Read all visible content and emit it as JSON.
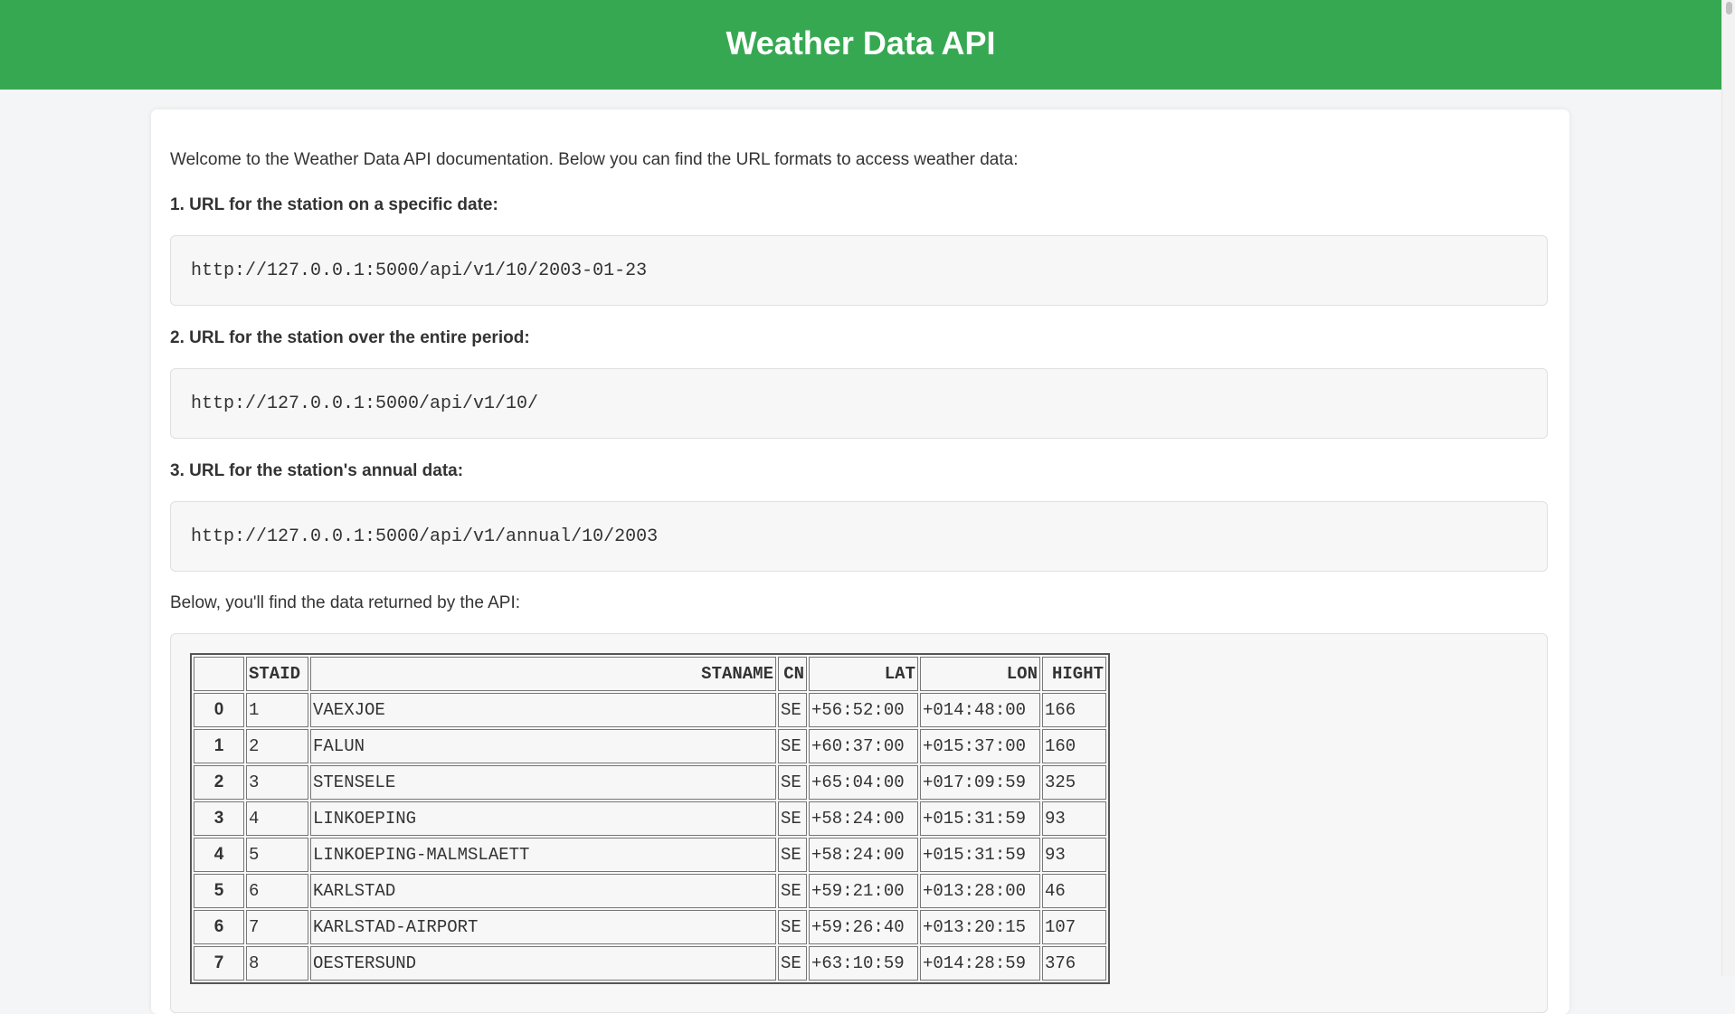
{
  "header": {
    "title": "Weather Data API"
  },
  "intro": "Welcome to the Weather Data API documentation. Below you can find the URL formats to access weather data:",
  "sections": [
    {
      "title": "1. URL for the station on a specific date:",
      "url": "http://127.0.0.1:5000/api/v1/10/2003-01-23"
    },
    {
      "title": "2. URL for the station over the entire period:",
      "url": "http://127.0.0.1:5000/api/v1/10/"
    },
    {
      "title": "3. URL for the station's annual data:",
      "url": "http://127.0.0.1:5000/api/v1/annual/10/2003"
    }
  ],
  "below_text": "Below, you'll find the data returned by the API:",
  "table": {
    "columns": [
      "",
      "STAID",
      "STANAME",
      "CN",
      "LAT",
      "LON",
      "HIGHT"
    ],
    "rows": [
      {
        "index": "0",
        "staid": "1",
        "staname": "VAEXJOE",
        "cn": "SE",
        "lat": "+56:52:00",
        "lon": "+014:48:00",
        "hight": "166"
      },
      {
        "index": "1",
        "staid": "2",
        "staname": "FALUN",
        "cn": "SE",
        "lat": "+60:37:00",
        "lon": "+015:37:00",
        "hight": "160"
      },
      {
        "index": "2",
        "staid": "3",
        "staname": "STENSELE",
        "cn": "SE",
        "lat": "+65:04:00",
        "lon": "+017:09:59",
        "hight": "325"
      },
      {
        "index": "3",
        "staid": "4",
        "staname": "LINKOEPING",
        "cn": "SE",
        "lat": "+58:24:00",
        "lon": "+015:31:59",
        "hight": "93"
      },
      {
        "index": "4",
        "staid": "5",
        "staname": "LINKOEPING-MALMSLAETT",
        "cn": "SE",
        "lat": "+58:24:00",
        "lon": "+015:31:59",
        "hight": "93"
      },
      {
        "index": "5",
        "staid": "6",
        "staname": "KARLSTAD",
        "cn": "SE",
        "lat": "+59:21:00",
        "lon": "+013:28:00",
        "hight": "46"
      },
      {
        "index": "6",
        "staid": "7",
        "staname": "KARLSTAD-AIRPORT",
        "cn": "SE",
        "lat": "+59:26:40",
        "lon": "+013:20:15",
        "hight": "107"
      },
      {
        "index": "7",
        "staid": "8",
        "staname": "OESTERSUND",
        "cn": "SE",
        "lat": "+63:10:59",
        "lon": "+014:28:59",
        "hight": "376"
      }
    ]
  }
}
